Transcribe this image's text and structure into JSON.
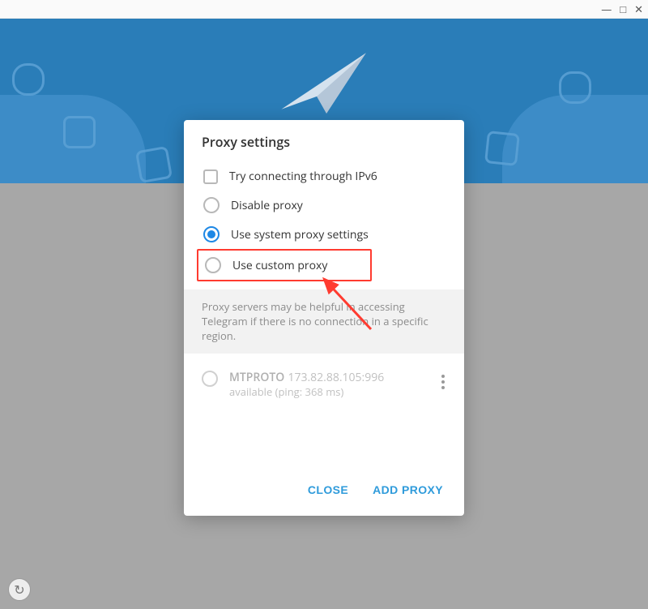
{
  "dialog": {
    "title": "Proxy settings",
    "options": {
      "ipv6_label": "Try connecting through IPv6",
      "disable_label": "Disable proxy",
      "system_label": "Use system proxy settings",
      "custom_label": "Use custom proxy",
      "selected": "system"
    },
    "info_text": "Proxy servers may be helpful in accessing Telegram if there is no connection in a specific region.",
    "proxies": [
      {
        "protocol": "MTPROTO",
        "address": "173.82.88.105:996",
        "status": "available (ping: 368 ms)"
      }
    ],
    "buttons": {
      "close": "CLOSE",
      "add": "ADD PROXY"
    }
  }
}
